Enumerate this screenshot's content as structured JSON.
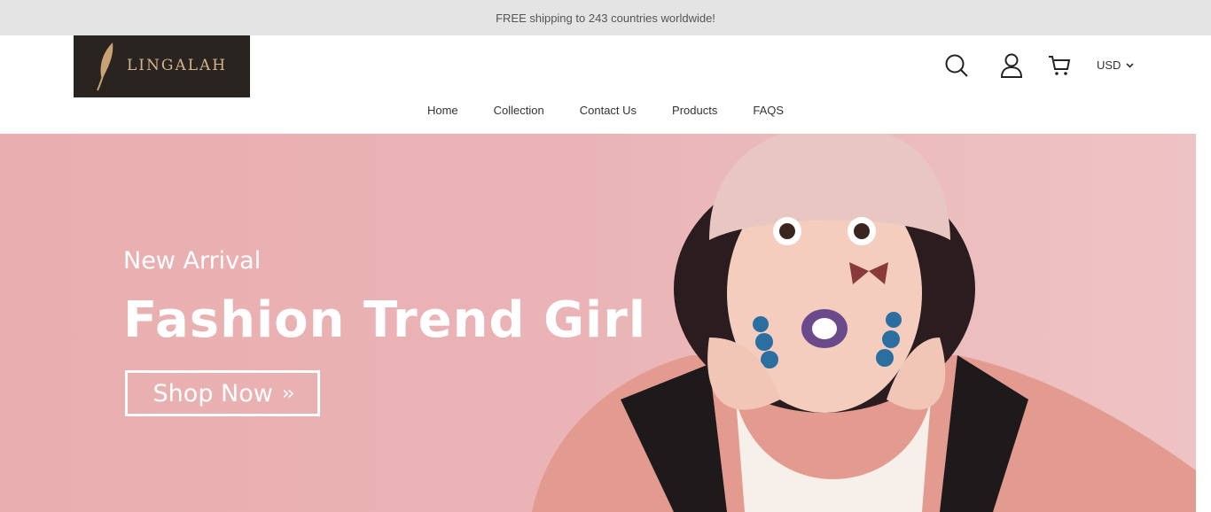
{
  "announcement": "FREE shipping to 243 countries worldwide!",
  "logo": {
    "text": "LINGALAH",
    "icon": "feather-icon"
  },
  "header_icons": [
    "search-icon",
    "user-icon",
    "cart-icon"
  ],
  "currency": {
    "selected": "USD",
    "icon": "chevron-down-icon"
  },
  "nav": [
    {
      "label": "Home"
    },
    {
      "label": "Collection"
    },
    {
      "label": "Contact Us"
    },
    {
      "label": "Products"
    },
    {
      "label": "FAQS"
    }
  ],
  "hero": {
    "subtitle": "New Arrival",
    "title": "Fashion Trend Girl",
    "button_label": "Shop Now",
    "button_icon": "double-chevron-right-icon",
    "image": "photo-of-surprised-girl-in-pink-beanie-and-jacket"
  },
  "colors": {
    "announcement_bg": "#e4e4e4",
    "logo_bg": "#2a2421",
    "logo_accent": "#d4b48a",
    "hero_bg": "#eab3b5"
  }
}
